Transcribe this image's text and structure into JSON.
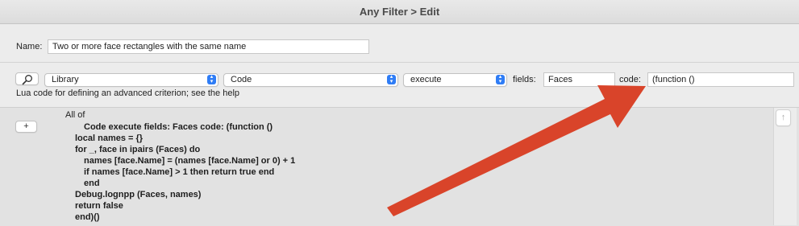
{
  "window": {
    "title": "Any Filter > Edit"
  },
  "name_row": {
    "label": "Name:",
    "value": "Two or more face rectangles with the same name"
  },
  "criterion_row": {
    "library_select": "Library",
    "code_select": "Code",
    "execute_select": "execute",
    "fields_label": "fields:",
    "fields_value": "Faces",
    "code_label": "code:",
    "code_value": "(function ()"
  },
  "help_text": "Lua code for defining an advanced criterion; see the help",
  "rule_editor": {
    "add_button_label": "+",
    "group_label": "All of",
    "lines": [
      "Code execute fields: Faces code: (function ()",
      "local names = {}",
      "for _, face in ipairs (Faces) do",
      "names [face.Name] = (names [face.Name] or 0) + 1",
      "if names [face.Name] > 1 then return true end",
      "end",
      "Debug.lognpp (Faces, names)",
      "return false",
      "end)()"
    ],
    "scroll_up_label": "↑"
  },
  "annotation": {
    "arrow_color": "#d9442a"
  },
  "colors": {
    "accent": "#2f7df6"
  }
}
